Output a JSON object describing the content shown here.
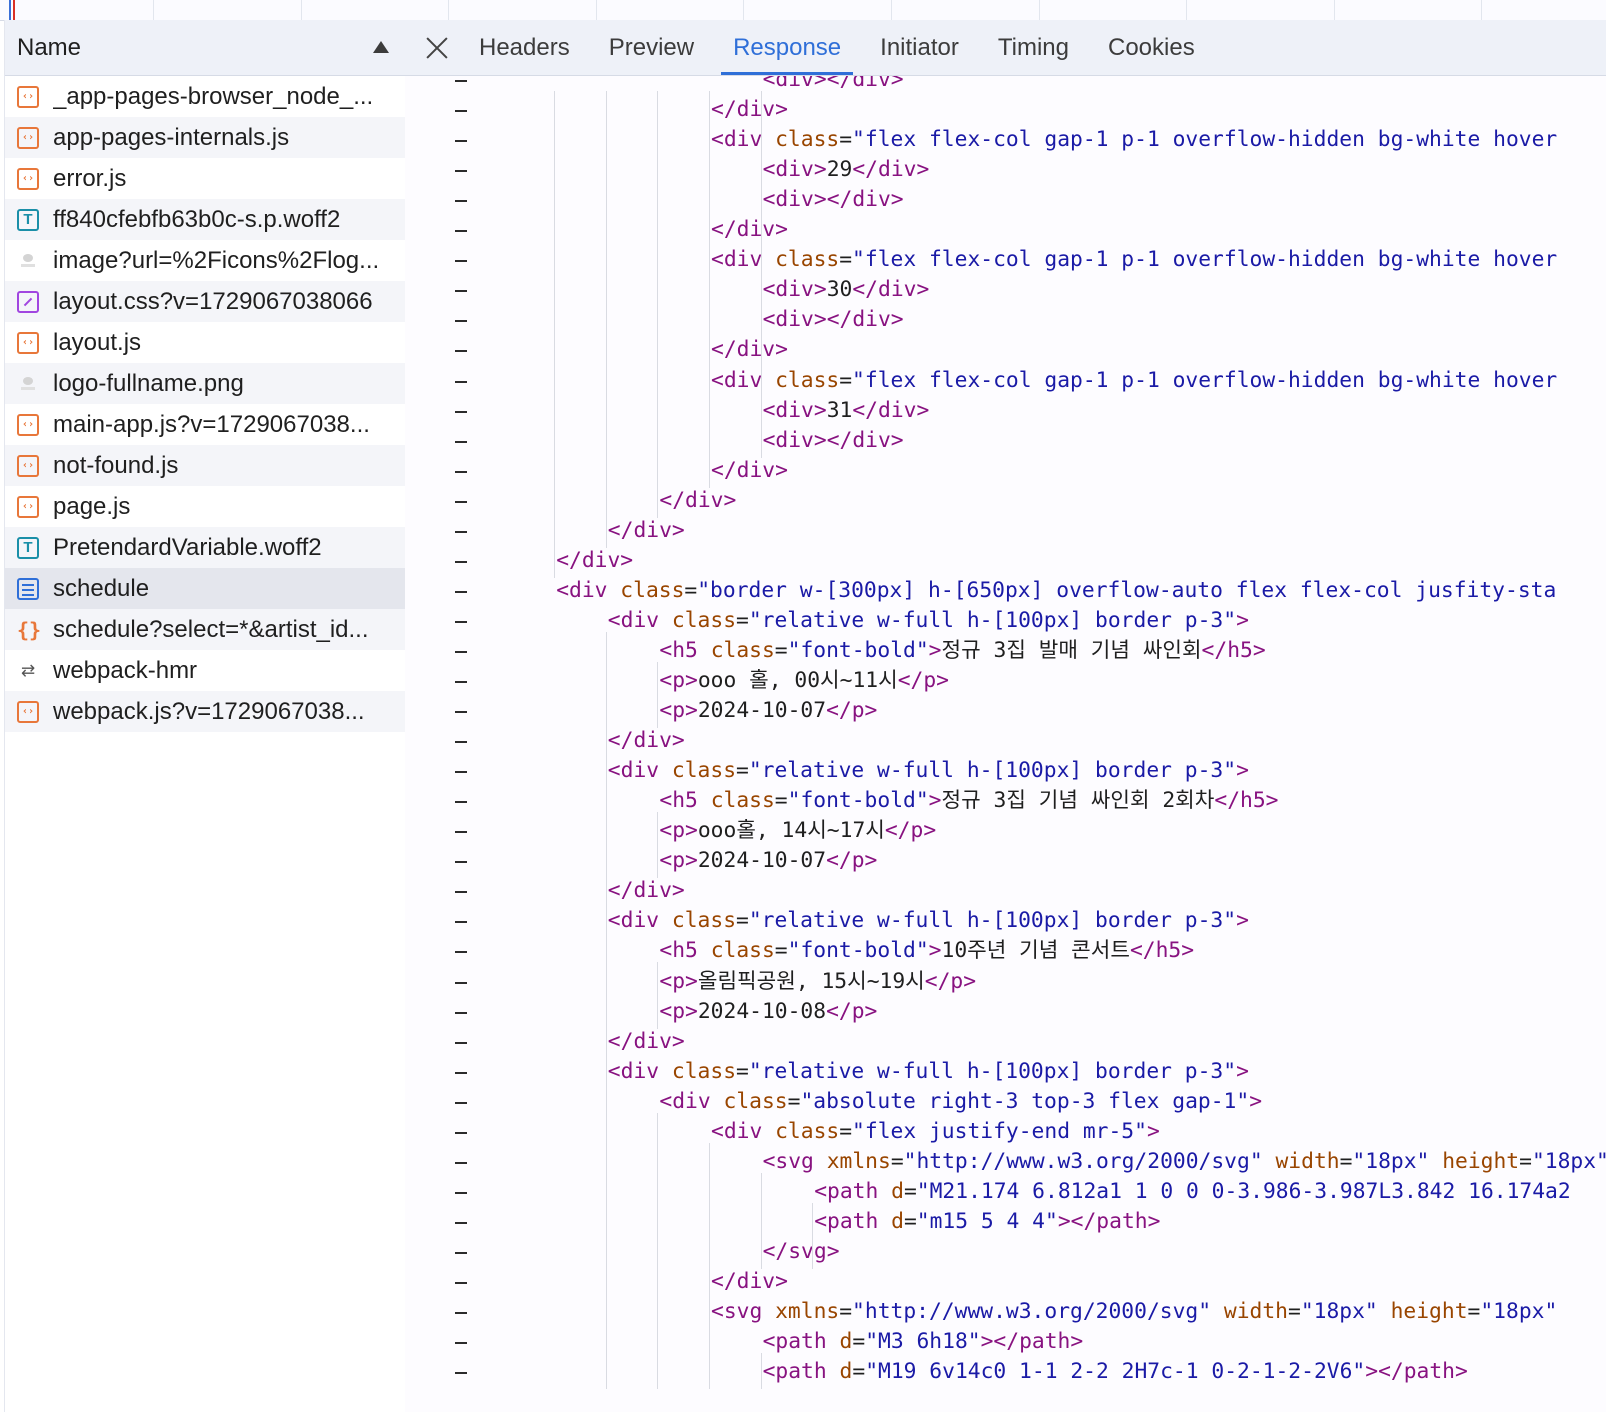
{
  "file_list": {
    "header_label": "Name",
    "files": [
      {
        "name": "_app-pages-browser_node_...",
        "icon": "script-icon"
      },
      {
        "name": "app-pages-internals.js",
        "icon": "script-icon"
      },
      {
        "name": "error.js",
        "icon": "script-icon"
      },
      {
        "name": "ff840cfebfb63b0c-s.p.woff2",
        "icon": "font-icon"
      },
      {
        "name": "image?url=%2Ficons%2Flog...",
        "icon": "image-icon"
      },
      {
        "name": "layout.css?v=1729067038066",
        "icon": "stylesheet-icon"
      },
      {
        "name": "layout.js",
        "icon": "script-icon"
      },
      {
        "name": "logo-fullname.png",
        "icon": "image-icon"
      },
      {
        "name": "main-app.js?v=1729067038...",
        "icon": "script-icon"
      },
      {
        "name": "not-found.js",
        "icon": "script-icon"
      },
      {
        "name": "page.js",
        "icon": "script-icon"
      },
      {
        "name": "PretendardVariable.woff2",
        "icon": "font-icon"
      },
      {
        "name": "schedule",
        "icon": "document-icon",
        "selected": true
      },
      {
        "name": "schedule?select=*&artist_id...",
        "icon": "fetch-icon"
      },
      {
        "name": "webpack-hmr",
        "icon": "websocket-icon"
      },
      {
        "name": "webpack.js?v=1729067038...",
        "icon": "script-icon"
      }
    ]
  },
  "tabs": [
    {
      "label": "Headers"
    },
    {
      "label": "Preview"
    },
    {
      "label": "Response",
      "active": true
    },
    {
      "label": "Initiator"
    },
    {
      "label": "Timing"
    },
    {
      "label": "Cookies"
    }
  ],
  "colors": {
    "accent": "#2f6fd8",
    "tag": "#881280",
    "attribute": "#994500",
    "attribute_value": "#1a1aa6",
    "script_icon": "#e8773a",
    "font_icon": "#1a8fa8",
    "css_icon": "#a146e0"
  },
  "code_lines": [
    {
      "indent": 6,
      "tokens": [
        [
          "tag",
          "<div>"
        ],
        [
          "tag",
          "</div>"
        ]
      ]
    },
    {
      "indent": 5,
      "tokens": [
        [
          "tag",
          "</div>"
        ]
      ]
    },
    {
      "indent": 5,
      "tokens": [
        [
          "tag",
          "<div "
        ],
        [
          "attr",
          "class"
        ],
        [
          "br",
          "="
        ],
        [
          "val",
          "\"flex flex-col gap-1 p-1 overflow-hidden bg-white hover"
        ]
      ]
    },
    {
      "indent": 6,
      "tokens": [
        [
          "tag",
          "<div>"
        ],
        [
          "text",
          "29"
        ],
        [
          "tag",
          "</div>"
        ]
      ]
    },
    {
      "indent": 6,
      "tokens": [
        [
          "tag",
          "<div>"
        ],
        [
          "tag",
          "</div>"
        ]
      ]
    },
    {
      "indent": 5,
      "tokens": [
        [
          "tag",
          "</div>"
        ]
      ]
    },
    {
      "indent": 5,
      "tokens": [
        [
          "tag",
          "<div "
        ],
        [
          "attr",
          "class"
        ],
        [
          "br",
          "="
        ],
        [
          "val",
          "\"flex flex-col gap-1 p-1 overflow-hidden bg-white hover"
        ]
      ]
    },
    {
      "indent": 6,
      "tokens": [
        [
          "tag",
          "<div>"
        ],
        [
          "text",
          "30"
        ],
        [
          "tag",
          "</div>"
        ]
      ]
    },
    {
      "indent": 6,
      "tokens": [
        [
          "tag",
          "<div>"
        ],
        [
          "tag",
          "</div>"
        ]
      ]
    },
    {
      "indent": 5,
      "tokens": [
        [
          "tag",
          "</div>"
        ]
      ]
    },
    {
      "indent": 5,
      "tokens": [
        [
          "tag",
          "<div "
        ],
        [
          "attr",
          "class"
        ],
        [
          "br",
          "="
        ],
        [
          "val",
          "\"flex flex-col gap-1 p-1 overflow-hidden bg-white hover"
        ]
      ]
    },
    {
      "indent": 6,
      "tokens": [
        [
          "tag",
          "<div>"
        ],
        [
          "text",
          "31"
        ],
        [
          "tag",
          "</div>"
        ]
      ]
    },
    {
      "indent": 6,
      "tokens": [
        [
          "tag",
          "<div>"
        ],
        [
          "tag",
          "</div>"
        ]
      ]
    },
    {
      "indent": 5,
      "tokens": [
        [
          "tag",
          "</div>"
        ]
      ]
    },
    {
      "indent": 4,
      "tokens": [
        [
          "tag",
          "</div>"
        ]
      ]
    },
    {
      "indent": 3,
      "tokens": [
        [
          "tag",
          "</div>"
        ]
      ]
    },
    {
      "indent": 2,
      "tokens": [
        [
          "tag",
          "</div>"
        ]
      ]
    },
    {
      "indent": 2,
      "tokens": [
        [
          "tag",
          "<div "
        ],
        [
          "attr",
          "class"
        ],
        [
          "br",
          "="
        ],
        [
          "val",
          "\"border w-[300px] h-[650px] overflow-auto flex flex-col jusfity-sta"
        ]
      ]
    },
    {
      "indent": 3,
      "tokens": [
        [
          "tag",
          "<div "
        ],
        [
          "attr",
          "class"
        ],
        [
          "br",
          "="
        ],
        [
          "val",
          "\"relative w-full h-[100px] border p-3\""
        ],
        [
          "tag",
          ">"
        ]
      ]
    },
    {
      "indent": 4,
      "tokens": [
        [
          "tag",
          "<h5 "
        ],
        [
          "attr",
          "class"
        ],
        [
          "br",
          "="
        ],
        [
          "val",
          "\"font-bold\""
        ],
        [
          "tag",
          ">"
        ],
        [
          "text",
          "정규 3집 발매 기념 싸인회"
        ],
        [
          "tag",
          "</h5>"
        ]
      ]
    },
    {
      "indent": 4,
      "tokens": [
        [
          "tag",
          "<p>"
        ],
        [
          "text",
          "ooo 홀, 00시~11시"
        ],
        [
          "tag",
          "</p>"
        ]
      ]
    },
    {
      "indent": 4,
      "tokens": [
        [
          "tag",
          "<p>"
        ],
        [
          "text",
          "2024-10-07"
        ],
        [
          "tag",
          "</p>"
        ]
      ]
    },
    {
      "indent": 3,
      "tokens": [
        [
          "tag",
          "</div>"
        ]
      ]
    },
    {
      "indent": 3,
      "tokens": [
        [
          "tag",
          "<div "
        ],
        [
          "attr",
          "class"
        ],
        [
          "br",
          "="
        ],
        [
          "val",
          "\"relative w-full h-[100px] border p-3\""
        ],
        [
          "tag",
          ">"
        ]
      ]
    },
    {
      "indent": 4,
      "tokens": [
        [
          "tag",
          "<h5 "
        ],
        [
          "attr",
          "class"
        ],
        [
          "br",
          "="
        ],
        [
          "val",
          "\"font-bold\""
        ],
        [
          "tag",
          ">"
        ],
        [
          "text",
          "정규 3집 기념 싸인회 2회차"
        ],
        [
          "tag",
          "</h5>"
        ]
      ]
    },
    {
      "indent": 4,
      "tokens": [
        [
          "tag",
          "<p>"
        ],
        [
          "text",
          "ooo홀, 14시~17시"
        ],
        [
          "tag",
          "</p>"
        ]
      ]
    },
    {
      "indent": 4,
      "tokens": [
        [
          "tag",
          "<p>"
        ],
        [
          "text",
          "2024-10-07"
        ],
        [
          "tag",
          "</p>"
        ]
      ]
    },
    {
      "indent": 3,
      "tokens": [
        [
          "tag",
          "</div>"
        ]
      ]
    },
    {
      "indent": 3,
      "tokens": [
        [
          "tag",
          "<div "
        ],
        [
          "attr",
          "class"
        ],
        [
          "br",
          "="
        ],
        [
          "val",
          "\"relative w-full h-[100px] border p-3\""
        ],
        [
          "tag",
          ">"
        ]
      ]
    },
    {
      "indent": 4,
      "tokens": [
        [
          "tag",
          "<h5 "
        ],
        [
          "attr",
          "class"
        ],
        [
          "br",
          "="
        ],
        [
          "val",
          "\"font-bold\""
        ],
        [
          "tag",
          ">"
        ],
        [
          "text",
          "10주년 기념 콘서트"
        ],
        [
          "tag",
          "</h5>"
        ]
      ]
    },
    {
      "indent": 4,
      "tokens": [
        [
          "tag",
          "<p>"
        ],
        [
          "text",
          "올림픽공원, 15시~19시"
        ],
        [
          "tag",
          "</p>"
        ]
      ]
    },
    {
      "indent": 4,
      "tokens": [
        [
          "tag",
          "<p>"
        ],
        [
          "text",
          "2024-10-08"
        ],
        [
          "tag",
          "</p>"
        ]
      ]
    },
    {
      "indent": 3,
      "tokens": [
        [
          "tag",
          "</div>"
        ]
      ]
    },
    {
      "indent": 3,
      "tokens": [
        [
          "tag",
          "<div "
        ],
        [
          "attr",
          "class"
        ],
        [
          "br",
          "="
        ],
        [
          "val",
          "\"relative w-full h-[100px] border p-3\""
        ],
        [
          "tag",
          ">"
        ]
      ]
    },
    {
      "indent": 4,
      "tokens": [
        [
          "tag",
          "<div "
        ],
        [
          "attr",
          "class"
        ],
        [
          "br",
          "="
        ],
        [
          "val",
          "\"absolute right-3 top-3 flex gap-1\""
        ],
        [
          "tag",
          ">"
        ]
      ]
    },
    {
      "indent": 5,
      "tokens": [
        [
          "tag",
          "<div "
        ],
        [
          "attr",
          "class"
        ],
        [
          "br",
          "="
        ],
        [
          "val",
          "\"flex justify-end mr-5\""
        ],
        [
          "tag",
          ">"
        ]
      ]
    },
    {
      "indent": 6,
      "tokens": [
        [
          "tag",
          "<svg "
        ],
        [
          "attr",
          "xmlns"
        ],
        [
          "br",
          "="
        ],
        [
          "val",
          "\"http://www.w3.org/2000/svg\""
        ],
        [
          "br",
          " "
        ],
        [
          "attr",
          "width"
        ],
        [
          "br",
          "="
        ],
        [
          "val",
          "\"18px\""
        ],
        [
          "br",
          " "
        ],
        [
          "attr",
          "height"
        ],
        [
          "br",
          "="
        ],
        [
          "val",
          "\"18px\""
        ]
      ]
    },
    {
      "indent": 7,
      "tokens": [
        [
          "tag",
          "<path "
        ],
        [
          "attr",
          "d"
        ],
        [
          "br",
          "="
        ],
        [
          "val",
          "\"M21.174 6.812a1 1 0 0 0-3.986-3.987L3.842 16.174a2"
        ]
      ]
    },
    {
      "indent": 7,
      "tokens": [
        [
          "tag",
          "<path "
        ],
        [
          "attr",
          "d"
        ],
        [
          "br",
          "="
        ],
        [
          "val",
          "\"m15 5 4 4\""
        ],
        [
          "tag",
          ">"
        ],
        [
          "tag",
          "</path>"
        ]
      ]
    },
    {
      "indent": 6,
      "tokens": [
        [
          "tag",
          "</svg>"
        ]
      ]
    },
    {
      "indent": 5,
      "tokens": [
        [
          "tag",
          "</div>"
        ]
      ]
    },
    {
      "indent": 5,
      "tokens": [
        [
          "tag",
          "<svg "
        ],
        [
          "attr",
          "xmlns"
        ],
        [
          "br",
          "="
        ],
        [
          "val",
          "\"http://www.w3.org/2000/svg\""
        ],
        [
          "br",
          " "
        ],
        [
          "attr",
          "width"
        ],
        [
          "br",
          "="
        ],
        [
          "val",
          "\"18px\""
        ],
        [
          "br",
          " "
        ],
        [
          "attr",
          "height"
        ],
        [
          "br",
          "="
        ],
        [
          "val",
          "\"18px\""
        ]
      ]
    },
    {
      "indent": 6,
      "tokens": [
        [
          "tag",
          "<path "
        ],
        [
          "attr",
          "d"
        ],
        [
          "br",
          "="
        ],
        [
          "val",
          "\"M3 6h18\""
        ],
        [
          "tag",
          ">"
        ],
        [
          "tag",
          "</path>"
        ]
      ]
    },
    {
      "indent": 6,
      "tokens": [
        [
          "tag",
          "<path "
        ],
        [
          "attr",
          "d"
        ],
        [
          "br",
          "="
        ],
        [
          "val",
          "\"M19 6v14c0 1-1 2-2 2H7c-1 0-2-1-2-2V6\""
        ],
        [
          "tag",
          ">"
        ],
        [
          "tag",
          "</path>"
        ]
      ]
    }
  ]
}
